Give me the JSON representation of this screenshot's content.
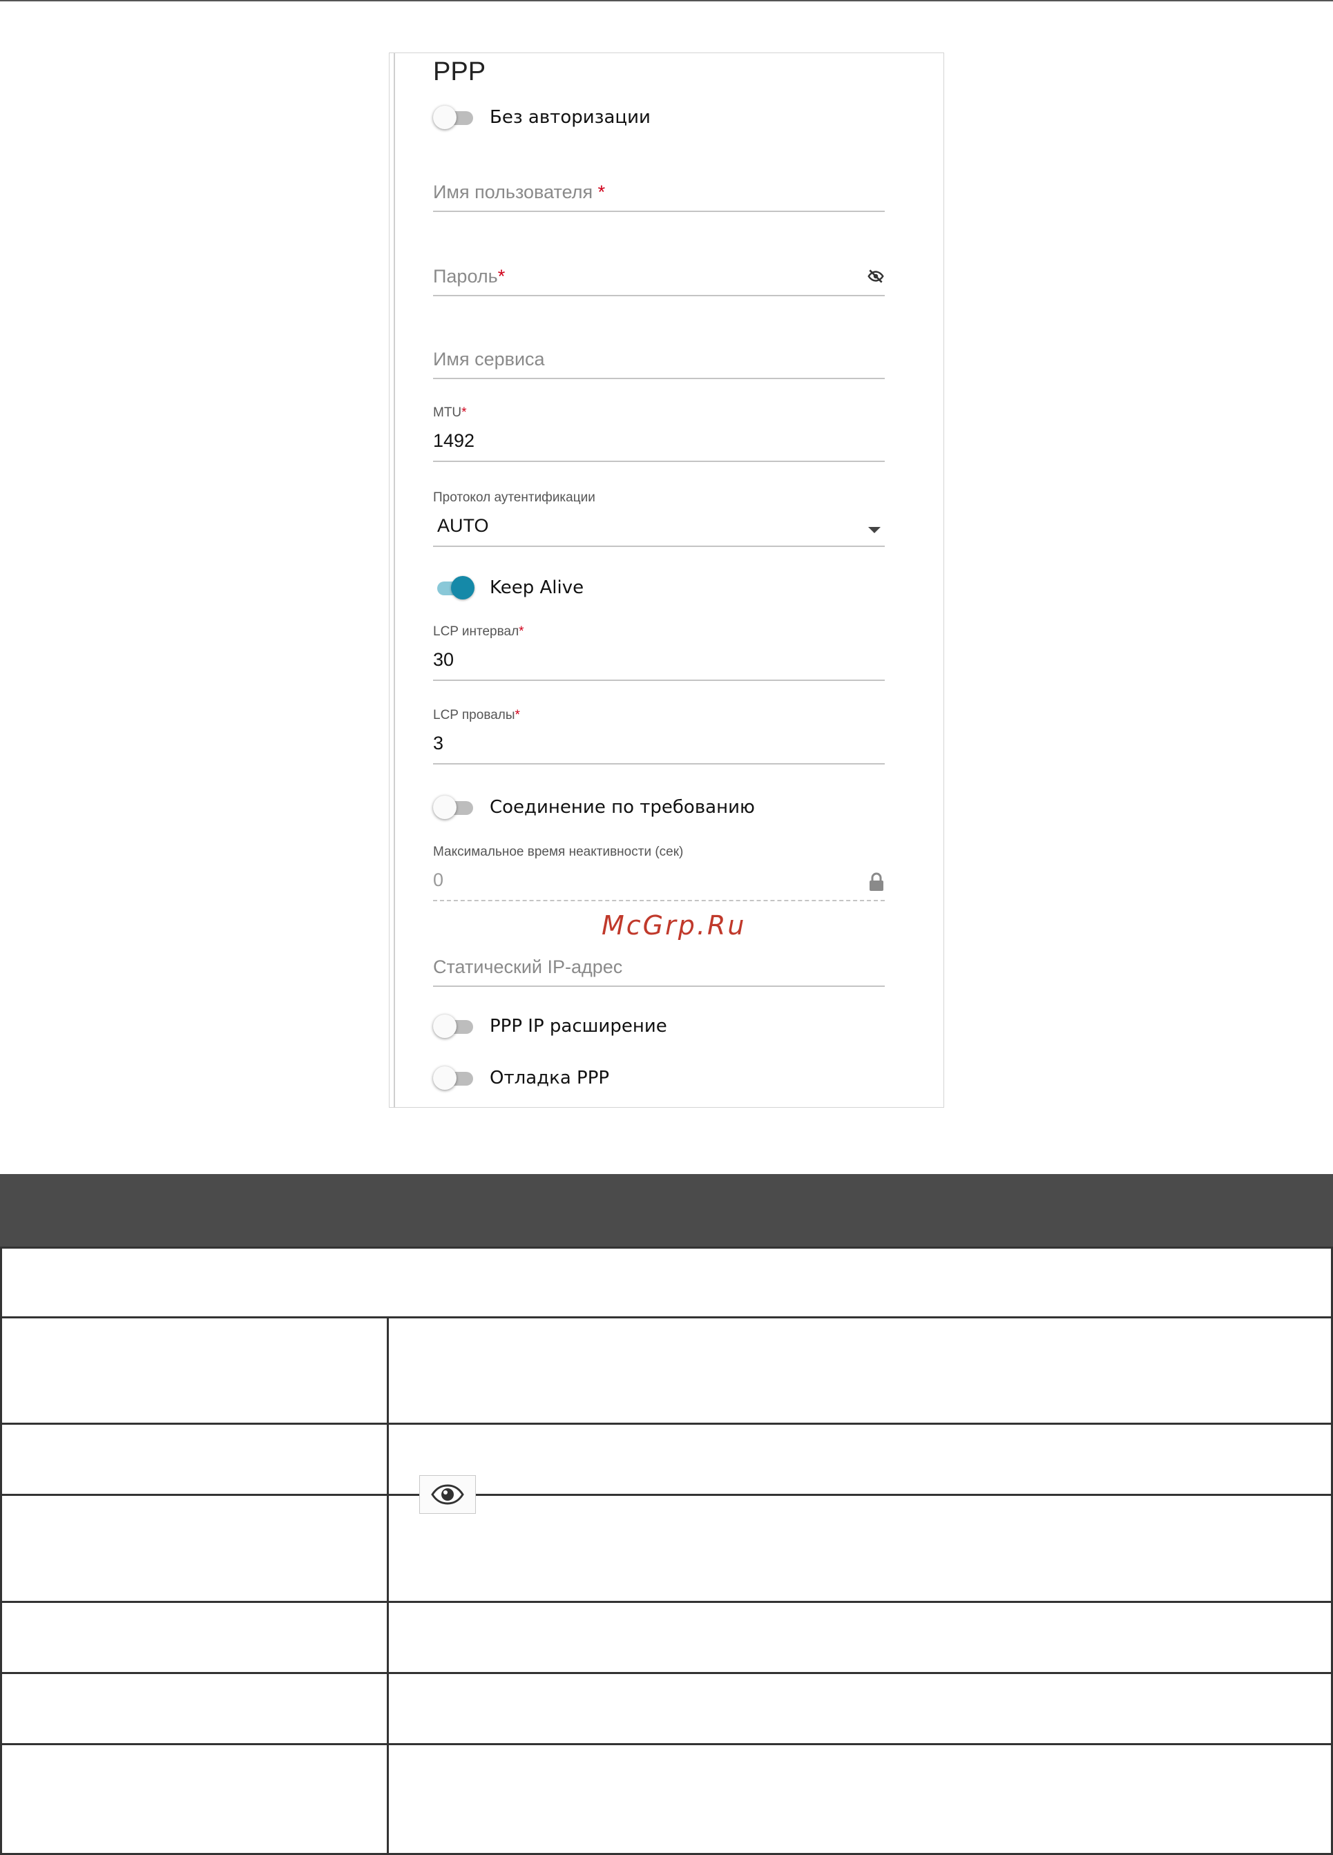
{
  "form": {
    "title": "PPP",
    "toggles": {
      "no_auth": {
        "label": "Без авторизации",
        "on": false
      },
      "keep_alive": {
        "label": "Keep Alive",
        "on": true
      },
      "dial_on_demand": {
        "label": "Соединение по требованию",
        "on": false
      },
      "ip_extension": {
        "label": "PPP IP расширение",
        "on": false
      },
      "debug": {
        "label": "Отладка PPP",
        "on": false
      }
    },
    "fields": {
      "username": {
        "placeholder": "Имя пользователя",
        "required_mark": "*",
        "value": ""
      },
      "password": {
        "placeholder": "Пароль",
        "required_mark": "*",
        "value": "",
        "icon": "eye-off-icon"
      },
      "service_name": {
        "placeholder": "Имя сервиса",
        "value": ""
      },
      "mtu": {
        "label": "MTU",
        "required_mark": "*",
        "value": "1492"
      },
      "auth_protocol": {
        "label": "Протокол аутентификации",
        "value": "AUTO",
        "icon": "caret-down-icon"
      },
      "lcp_interval": {
        "label": "LCP интервал",
        "required_mark": "*",
        "value": "30"
      },
      "lcp_failures": {
        "label": "LCP провалы",
        "required_mark": "*",
        "value": "3"
      },
      "max_idle": {
        "label": "Максимальное время неактивности (сек)",
        "value": "0",
        "disabled": true,
        "icon": "lock-icon"
      },
      "static_ip": {
        "placeholder": "Статический IP-адрес",
        "value": ""
      }
    }
  },
  "watermark": "McGrp.Ru",
  "table": {
    "icon_in_row3": "eye-icon"
  },
  "colors": {
    "accent": "#1589a8",
    "accent_track": "#89c8d8",
    "required": "#d0021b",
    "table_header": "#4b4b4b",
    "watermark": "#c0392b"
  }
}
